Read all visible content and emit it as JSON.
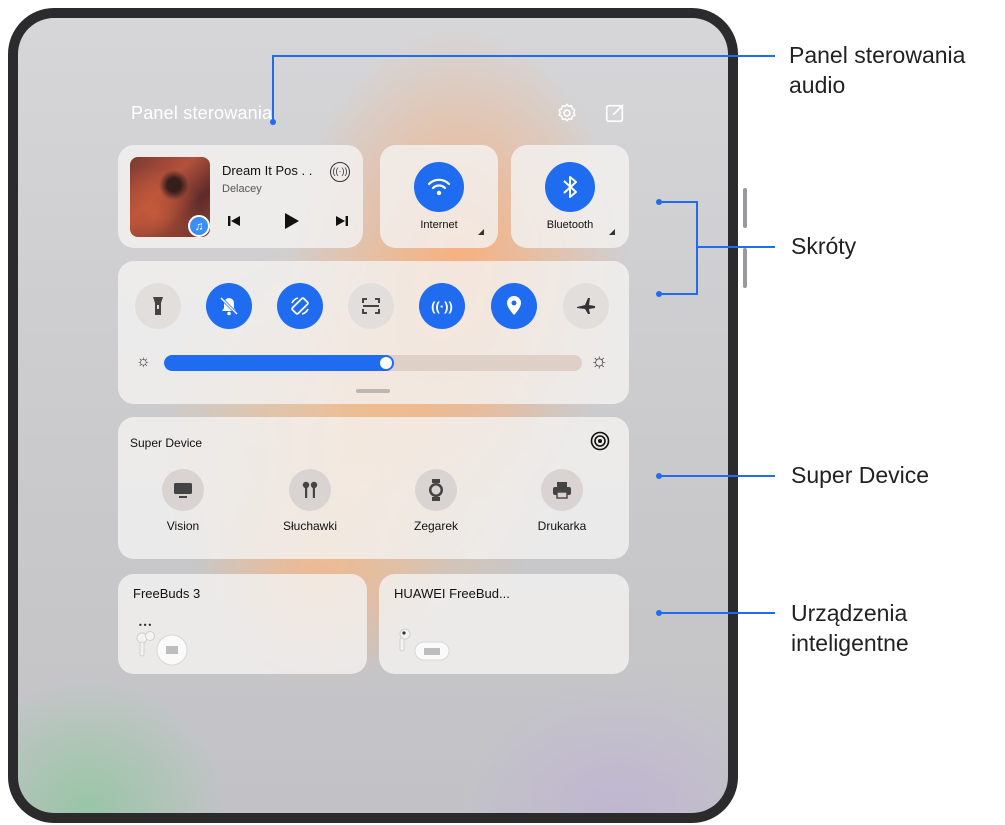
{
  "panel": {
    "title": "Panel sterowania",
    "settings_icon": "gear-icon",
    "edit_icon": "edit-icon"
  },
  "media": {
    "song_title": "Dream It Pos . .",
    "artist": "Delacey",
    "controls": [
      "previous-icon",
      "play-icon",
      "next-icon"
    ]
  },
  "tiles": [
    {
      "label": "Internet",
      "icon": "wifi-icon",
      "state": "on"
    },
    {
      "label": "Bluetooth",
      "icon": "bluetooth-icon",
      "state": "on"
    }
  ],
  "shortcuts": [
    {
      "icon": "flashlight-icon",
      "state": "off"
    },
    {
      "icon": "mute-bell-icon",
      "state": "on"
    },
    {
      "icon": "auto-rotate-icon",
      "state": "on"
    },
    {
      "icon": "scan-icon",
      "state": "off"
    },
    {
      "icon": "hotspot-icon",
      "state": "on"
    },
    {
      "icon": "location-icon",
      "state": "on"
    },
    {
      "icon": "airplane-icon",
      "state": "off"
    }
  ],
  "brightness": {
    "level": 0.55
  },
  "super_device": {
    "title": "Super Device",
    "devices": [
      {
        "label": "Vision",
        "icon": "tv-icon"
      },
      {
        "label": "Słuchawki",
        "icon": "earbuds-icon"
      },
      {
        "label": "Zegarek",
        "icon": "watch-icon"
      },
      {
        "label": "Drukarka",
        "icon": "printer-icon"
      }
    ]
  },
  "smart_devices": [
    {
      "name": "FreeBuds 3"
    },
    {
      "name": "HUAWEI FreeBud..."
    }
  ],
  "callouts": {
    "audio": "Panel sterowania audio",
    "shortcuts": "Skróty",
    "super_device": "Super Device",
    "smart": "Urządzenia inteligentne"
  },
  "colors": {
    "accent": "#1f6cf0",
    "callout": "#1f6cf0"
  }
}
